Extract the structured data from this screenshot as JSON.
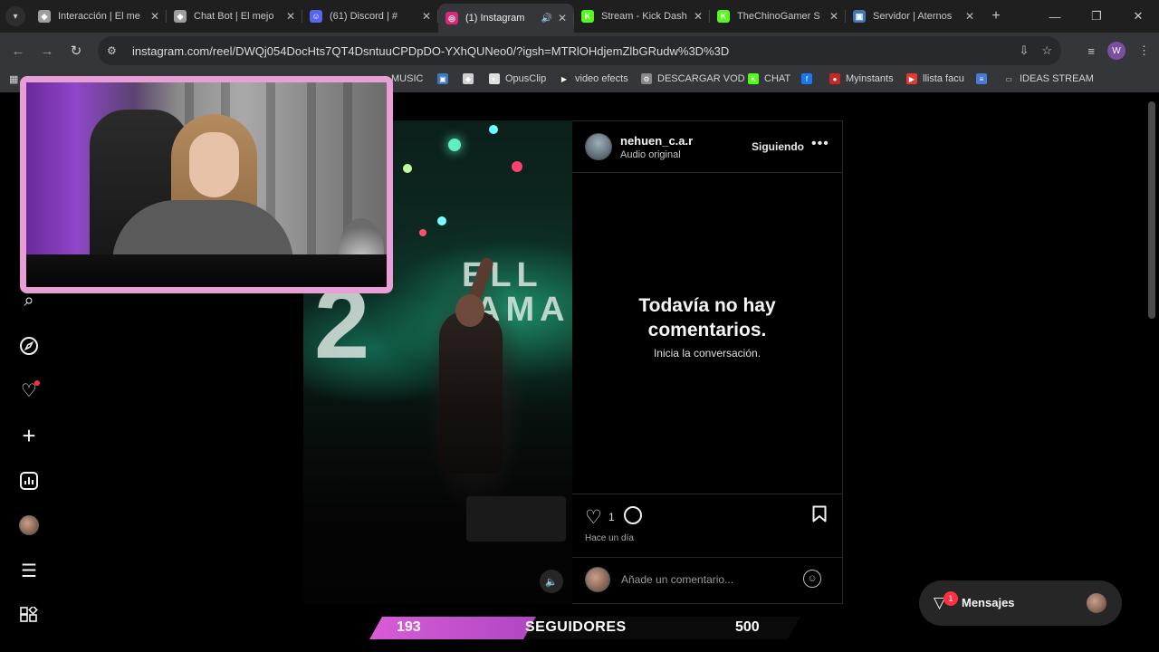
{
  "browser": {
    "tabs": [
      {
        "title": "Interacción | El me",
        "favicon_color": "#9e9e9e",
        "favicon_icon": "diamond-icon",
        "active": false
      },
      {
        "title": "Chat Bot | El mejo",
        "favicon_color": "#9e9e9e",
        "favicon_icon": "diamond-icon",
        "active": false
      },
      {
        "title": "(61) Discord | #",
        "favicon_color": "#5865f2",
        "favicon_icon": "discord-icon",
        "active": false
      },
      {
        "title": "(1) Instagram",
        "favicon_color": "#d62976",
        "favicon_icon": "instagram-icon",
        "active": true
      },
      {
        "title": "Stream - Kick Dash",
        "favicon_color": "#53fc18",
        "favicon_icon": "kick-icon",
        "active": false
      },
      {
        "title": "TheChinoGamer S",
        "favicon_color": "#53fc18",
        "favicon_icon": "kick-icon",
        "active": false
      },
      {
        "title": "Servidor | Aternos",
        "favicon_color": "#3d7ab8",
        "favicon_icon": "aternos-icon",
        "active": false
      }
    ],
    "url": "instagram.com/reel/DWQj054DocHts7QT4DsntuuCPDpDO-YXhQUNeo0/?igsh=MTRlOHdjemZlbGRudw%3D%3D",
    "profile_initial": "W",
    "bookmarks": [
      {
        "label": "MUSIC",
        "color": "#e0e0e0",
        "icon": "music-icon"
      },
      {
        "label": "",
        "color": "#3d7ab8",
        "icon": "square-icon"
      },
      {
        "label": "",
        "color": "#d0d0d0",
        "icon": "diamond-icon"
      },
      {
        "label": "OpusClip",
        "color": "#e0e0e0",
        "icon": "opusclip-icon"
      },
      {
        "label": "video efects",
        "color": "#333333",
        "icon": "video-icon"
      },
      {
        "label": "DESCARGAR VOD",
        "color": "#888888",
        "icon": "gear-icon"
      },
      {
        "label": "CHAT",
        "color": "#53fc18",
        "icon": "kick-icon"
      },
      {
        "label": "",
        "color": "#1877f2",
        "icon": "facebook-icon"
      },
      {
        "label": "Myinstants",
        "color": "#c62828",
        "icon": "myinstants-icon"
      },
      {
        "label": "llista facu",
        "color": "#e53935",
        "icon": "youtube-icon"
      },
      {
        "label": "",
        "color": "#4a7bd0",
        "icon": "docs-icon"
      },
      {
        "label": "IDEAS STREAM",
        "color": "#cccccc",
        "icon": "folder-icon"
      }
    ]
  },
  "instagram": {
    "post": {
      "username": "nehuen_c.a.r",
      "audio": "Audio original",
      "follow_status": "Siguiendo",
      "empty_title_line1": "Todavía no hay",
      "empty_title_line2": "comentarios.",
      "empty_subtitle": "Inicia la conversación.",
      "likes": "1",
      "time_ago": "Hace un día",
      "comment_placeholder": "Añade un comentario...",
      "video_overlay_text": "2",
      "video_banner_text": "ELL",
      "video_banner_text2": "AMA"
    },
    "messages": {
      "label": "Mensajes",
      "unread": "1"
    },
    "sidebar_icons": [
      "search-icon",
      "explore-icon",
      "heart-icon",
      "create-icon",
      "dashboard-icon",
      "profile-icon",
      "menu-icon",
      "more-icon"
    ]
  },
  "stream_overlay": {
    "followers_current": "193",
    "followers_label": "SEGUIDORES",
    "followers_goal": "500",
    "progress_fraction": 0.386
  }
}
